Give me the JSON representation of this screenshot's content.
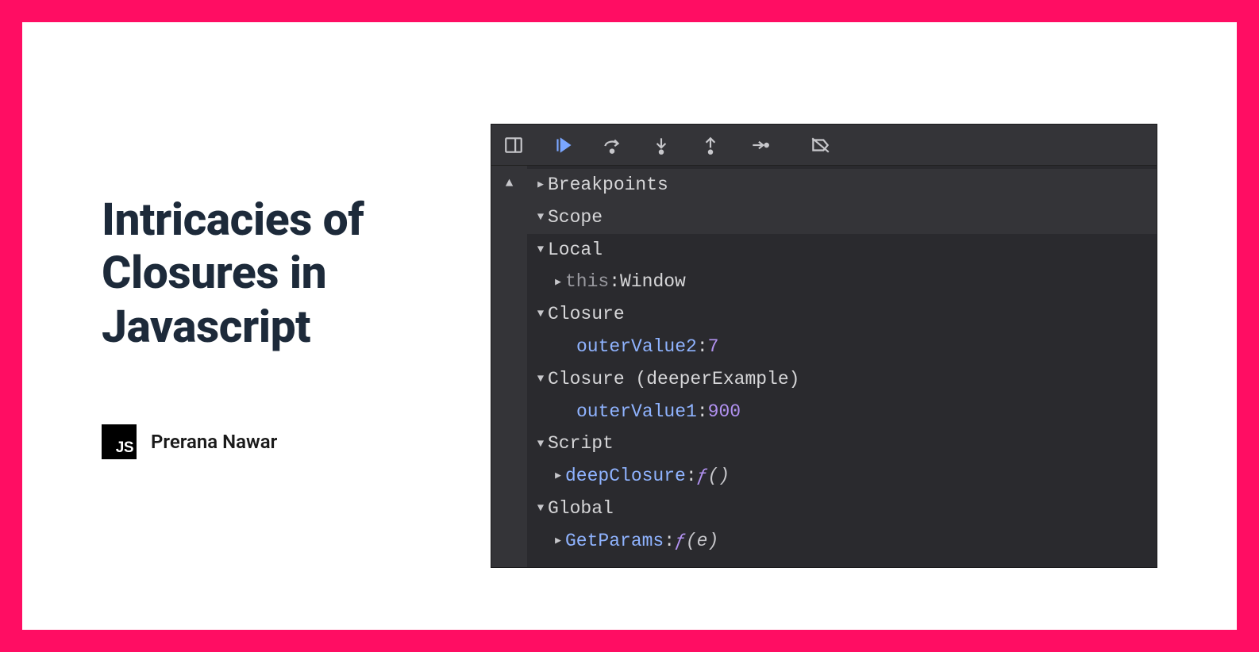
{
  "title": "Intricacies of Closures in Javascript",
  "author": "Prerana Nawar",
  "js_badge": "JS",
  "colors": {
    "accent_border": "#ff0d63",
    "title_color": "#1d2a3a",
    "panel_bg": "#2a2a2e",
    "toolbar_bg": "#343438",
    "prop_color": "#8fb3ff",
    "num_color": "#b191f0",
    "play_accent": "#7aa6ff"
  },
  "devtools": {
    "toolbar_icons": [
      "dock-icon",
      "play-icon",
      "step-over-icon",
      "step-into-icon",
      "step-out-icon",
      "step-icon",
      "deactivate-breakpoints-icon"
    ],
    "sections": {
      "breakpoints": {
        "label": "Breakpoints",
        "expanded": false
      },
      "scope": {
        "label": "Scope",
        "expanded": true,
        "groups": [
          {
            "label": "Local",
            "expanded": true,
            "items": [
              {
                "key": "this",
                "key_class": "kw-this",
                "sep": ": ",
                "value": "Window",
                "value_class": "lbl",
                "expandable": true,
                "expanded": false
              }
            ]
          },
          {
            "label": "Closure",
            "expanded": true,
            "items": [
              {
                "key": "outerValue2",
                "key_class": "prop",
                "sep": ": ",
                "value": "7",
                "value_class": "num",
                "expandable": false
              }
            ]
          },
          {
            "label": "Closure (deeperExample)",
            "expanded": true,
            "items": [
              {
                "key": "outerValue1",
                "key_class": "prop",
                "sep": ": ",
                "value": "900",
                "value_class": "num",
                "expandable": false
              }
            ]
          },
          {
            "label": "Script",
            "expanded": true,
            "items": [
              {
                "key": "deepClosure",
                "key_class": "prop",
                "sep": ": ",
                "value_fn": "()",
                "expandable": true,
                "expanded": false
              }
            ]
          },
          {
            "label": "Global",
            "expanded": true,
            "items": [
              {
                "key": "GetParams",
                "key_class": "prop",
                "sep": ": ",
                "value_fn": "(e)",
                "expandable": true,
                "expanded": false
              }
            ]
          }
        ]
      }
    }
  }
}
